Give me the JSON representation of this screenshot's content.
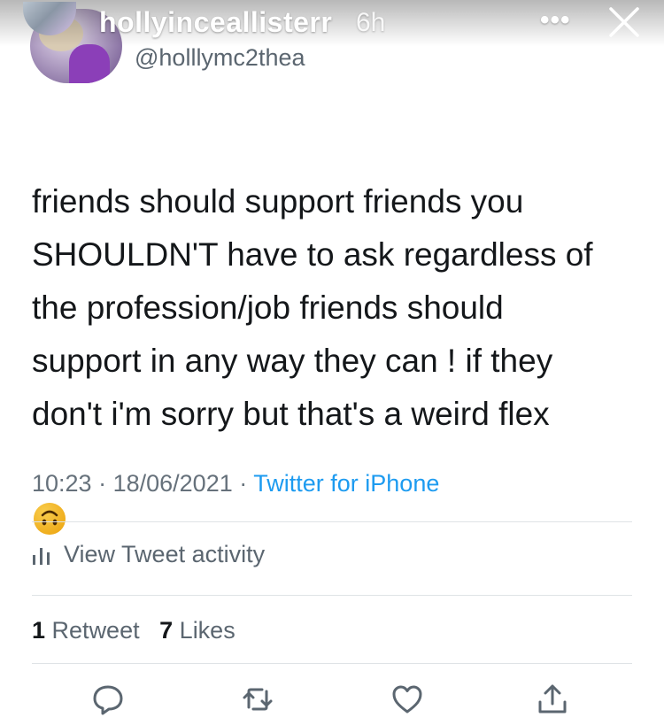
{
  "story": {
    "username": "hollyinceallisterr",
    "time": "6h",
    "more_label": "•••",
    "close_icon": "close-icon"
  },
  "tweet": {
    "handle": "@holllymc2thea",
    "text": "friends should support friends you\nSHOULDN'T have to ask regardless of\nthe profession/job friends should\nsupport in any way they can ! if they\ndon't i'm sorry but that's a weird flex",
    "emoji": "🙃",
    "time": "10:23",
    "date": "18/06/2021",
    "source": "Twitter for iPhone",
    "activity_label": "View Tweet activity",
    "retweet_count": "1",
    "retweet_label": "Retweet",
    "like_count": "7",
    "like_label": "Likes"
  },
  "actions": [
    "reply-icon",
    "retweet-icon",
    "like-icon",
    "share-icon"
  ],
  "colors": {
    "text": "#14171a",
    "secondary": "#5b6670",
    "link": "#1d9bf0",
    "divider": "#dfe3e6",
    "emoji": "#f5b820"
  }
}
